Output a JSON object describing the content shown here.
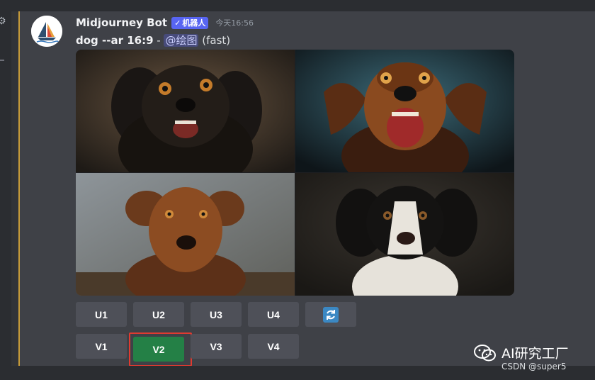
{
  "message": {
    "username": "Midjourney Bot",
    "bot_badge": "机器人",
    "timestamp": "今天16:56",
    "prompt": "dog --ar 16:9",
    "separator": " - ",
    "mention": "@绘图",
    "speed": "(fast)"
  },
  "upscale_buttons": [
    "U1",
    "U2",
    "U3",
    "U4"
  ],
  "variation_buttons": [
    "V1",
    "V2",
    "V3",
    "V4"
  ],
  "active_button": "V2",
  "watermark": {
    "brand": "AI研究工厂",
    "credit": "CSDN @super5"
  },
  "colors": {
    "accent": "#5865f2",
    "active_green": "#248046",
    "highlight_red": "#e03a30"
  },
  "icons": [
    "settings-gear-icon",
    "wechat-icon",
    "reroll-icon",
    "verified-check-icon"
  ]
}
